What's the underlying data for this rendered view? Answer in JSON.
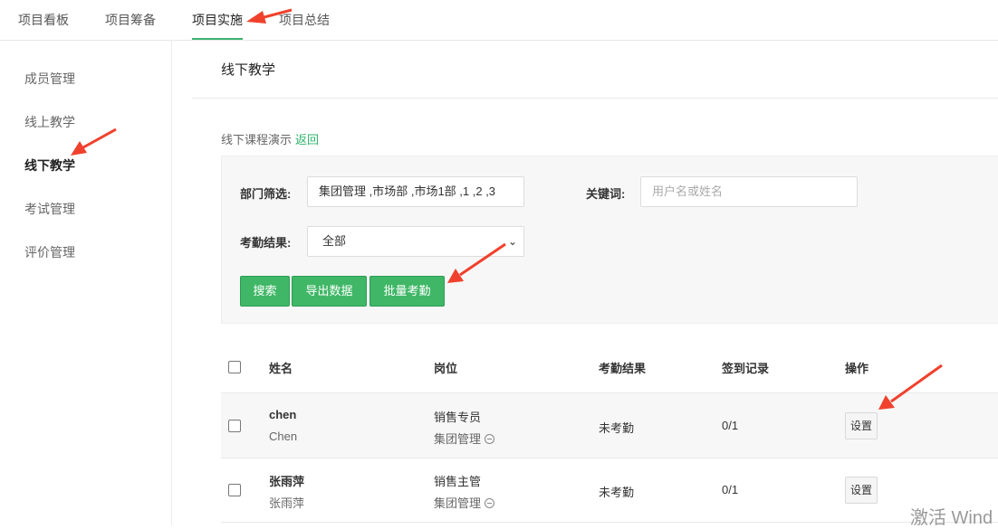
{
  "top_tabs": [
    "项目看板",
    "项目筹备",
    "项目实施",
    "项目总结"
  ],
  "active_tab": "项目实施",
  "sidebar": [
    "成员管理",
    "线上教学",
    "线下教学",
    "考试管理",
    "评价管理"
  ],
  "page_title": "线下教学",
  "breadcrumb": {
    "text": "线下课程演示",
    "back_link": "返回"
  },
  "filter": {
    "dept_label": "部门筛选:",
    "dept_value": "集团管理 ,市场部 ,市场1部 ,1 ,2 ,3",
    "keyword_label": "关键词:",
    "keyword_placeholder": "用户名或姓名",
    "attendance_label": "考勤结果:",
    "attendance_value": "全部",
    "buttons": [
      "搜索",
      "导出数据",
      "批量考勤"
    ]
  },
  "table": {
    "headers": [
      "姓名",
      "岗位",
      "考勤结果",
      "签到记录",
      "操作"
    ],
    "rows": [
      {
        "name": "chen",
        "real_name": "Chen",
        "position": "销售专员",
        "dept": "集团管理",
        "attendance": "未考勤",
        "signin": "0/1",
        "action": "设置"
      },
      {
        "name": "张雨萍",
        "real_name": "张雨萍",
        "position": "销售主管",
        "dept": "集团管理",
        "attendance": "未考勤",
        "signin": "0/1",
        "action": "设置"
      }
    ]
  },
  "watermark": "激活 Wind",
  "colors": {
    "accent": "#3fb766",
    "arrow": "#f0412c"
  }
}
